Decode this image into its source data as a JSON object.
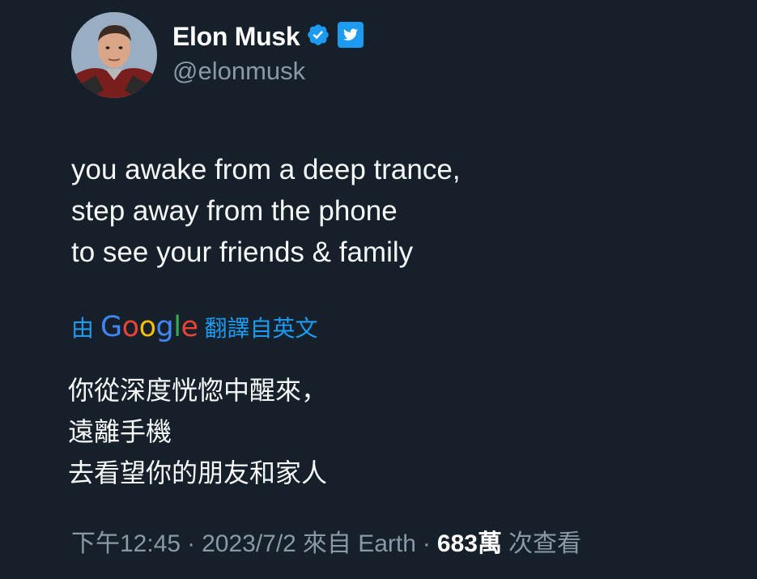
{
  "author": {
    "display_name": "Elon Musk",
    "handle": "@elonmusk"
  },
  "badges": {
    "verified_icon": "verified-badge-icon",
    "affiliation_icon": "twitter-bird-icon",
    "verified_color": "#1d9bf0"
  },
  "tweet": {
    "lines": [
      "you awake from a deep trance,",
      "step away from the phone",
      "to see your friends & family"
    ]
  },
  "translation": {
    "prefix": "由",
    "provider_letters": [
      "G",
      "o",
      "o",
      "g",
      "l",
      "e"
    ],
    "suffix": "翻譯自英文",
    "lines": [
      "你從深度恍惚中醒來，",
      "遠離手機",
      "去看望你的朋友和家人"
    ]
  },
  "meta": {
    "time": "下午12:45",
    "separator": "·",
    "date": "2023/7/2",
    "source": "來自 Earth",
    "views_count": "683萬",
    "views_label": "次查看"
  },
  "colors": {
    "background": "#15202b",
    "text_primary": "#f7f9f9",
    "text_secondary": "#8b98a5",
    "accent": "#1d9bf0"
  }
}
